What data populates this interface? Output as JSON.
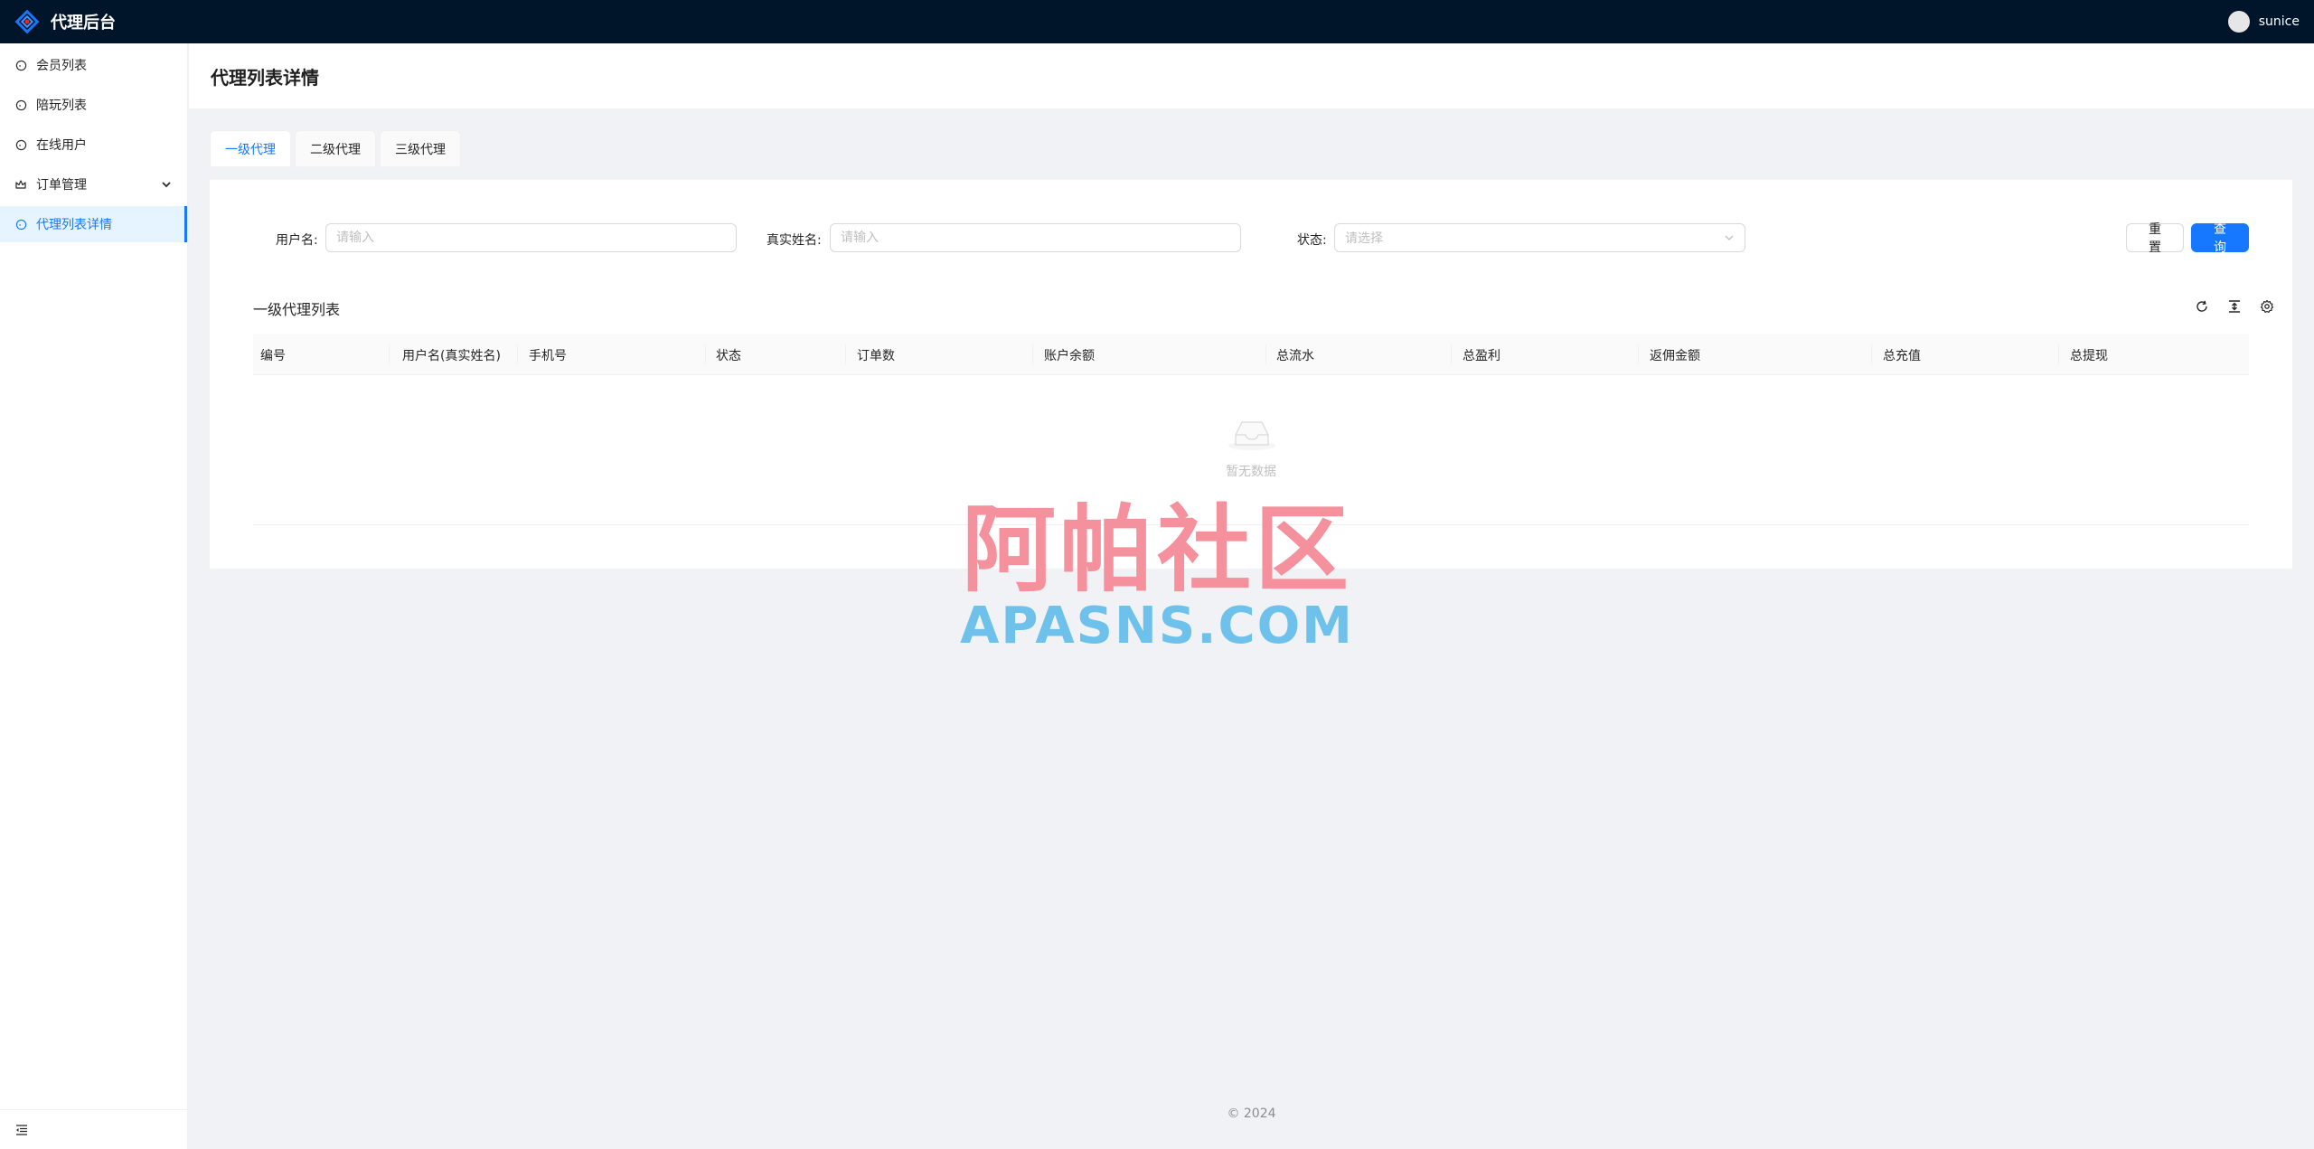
{
  "app": {
    "title": "代理后台",
    "user": "sunice"
  },
  "sidebar": {
    "items": [
      {
        "label": "会员列表",
        "icon": "circle-icon"
      },
      {
        "label": "陪玩列表",
        "icon": "circle-icon"
      },
      {
        "label": "在线用户",
        "icon": "circle-icon"
      },
      {
        "label": "订单管理",
        "icon": "crown-icon",
        "expandable": true
      },
      {
        "label": "代理列表详情",
        "icon": "circle-icon",
        "active": true
      }
    ]
  },
  "page": {
    "title": "代理列表详情"
  },
  "tabs": [
    {
      "label": "一级代理",
      "active": true
    },
    {
      "label": "二级代理"
    },
    {
      "label": "三级代理"
    }
  ],
  "search": {
    "username": {
      "label": "用户名:",
      "placeholder": "请输入"
    },
    "realname": {
      "label": "真实姓名:",
      "placeholder": "请输入"
    },
    "status": {
      "label": "状态:",
      "placeholder": "请选择"
    },
    "reset_label": "重 置",
    "query_label": "查 询"
  },
  "table": {
    "title": "一级代理列表",
    "columns": [
      "编号",
      "用户名(真实姓名)",
      "手机号",
      "状态",
      "订单数",
      "账户余额",
      "总流水",
      "总盈利",
      "返佣金额",
      "总充值",
      "总提现"
    ],
    "empty_text": "暂无数据"
  },
  "watermark": {
    "cn": "阿帕社区",
    "en": "APASNS.COM"
  },
  "footer": {
    "text": "© 2024"
  },
  "colors": {
    "header_bg": "#001529",
    "primary": "#1677ff",
    "page_bg": "#f0f2f5"
  }
}
